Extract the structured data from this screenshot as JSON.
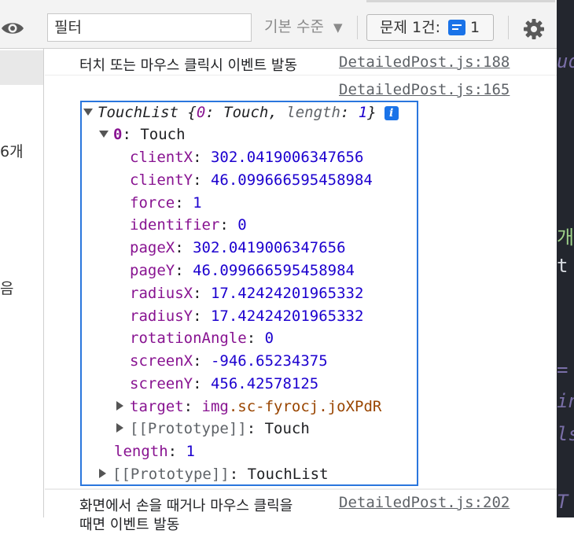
{
  "toolbar": {
    "filter_value": "필터",
    "level_label": "기본 수준",
    "level_arrow": "▼",
    "issues_label": "문제 1건:",
    "issues_count": "1"
  },
  "sidebar": {
    "fragment_1": "6개",
    "fragment_2": "음"
  },
  "editor": {
    "fragments": [
      "ud",
      "개니",
      "t",
      "=",
      "in",
      "ls",
      "T"
    ]
  },
  "console": {
    "msg1": {
      "text": "터치 또는 마우스 클릭시 이벤트 발동",
      "source": "DetailedPost.js:188"
    },
    "msg2": {
      "source": "DetailedPost.js:165"
    },
    "object": {
      "header_name": "TouchList",
      "header_preview_open": " {",
      "header_key0": "0",
      "header_colon0": ": Touch, ",
      "header_key_len": "length",
      "header_colon_len": ": ",
      "header_len_val": "1",
      "header_close": "}",
      "info_glyph": "i",
      "item0_key": "0",
      "item0_type": ": Touch",
      "props": [
        {
          "key": "clientX",
          "value": "302.0419006347656"
        },
        {
          "key": "clientY",
          "value": "46.099666595458984"
        },
        {
          "key": "force",
          "value": "1"
        },
        {
          "key": "identifier",
          "value": "0"
        },
        {
          "key": "pageX",
          "value": "302.0419006347656"
        },
        {
          "key": "pageY",
          "value": "46.099666595458984"
        },
        {
          "key": "radiusX",
          "value": "17.42424201965332"
        },
        {
          "key": "radiusY",
          "value": "17.42424201965332"
        },
        {
          "key": "rotationAngle",
          "value": "0"
        },
        {
          "key": "screenX",
          "value": "-946.65234375"
        },
        {
          "key": "screenY",
          "value": "456.42578125"
        }
      ],
      "target_key": "target",
      "target_tag": "img",
      "target_class": ".sc-fyrocj.joXPdR",
      "proto_inner_key": "[[Prototype]]",
      "proto_inner_val": "Touch",
      "length_key": "length",
      "length_val": "1",
      "proto_outer_key": "[[Prototype]]",
      "proto_outer_val": "TouchList"
    },
    "msg3": {
      "text": "화면에서 손을 때거나 마우스 클릭을",
      "text2": "때면 이벤트 발동",
      "source": "DetailedPost.js:202"
    }
  },
  "colors": {
    "key": "#881391",
    "number": "#1c00cf",
    "string": "#994500",
    "highlight_border": "#2a76dd",
    "issue_blue": "#1a73e8"
  }
}
